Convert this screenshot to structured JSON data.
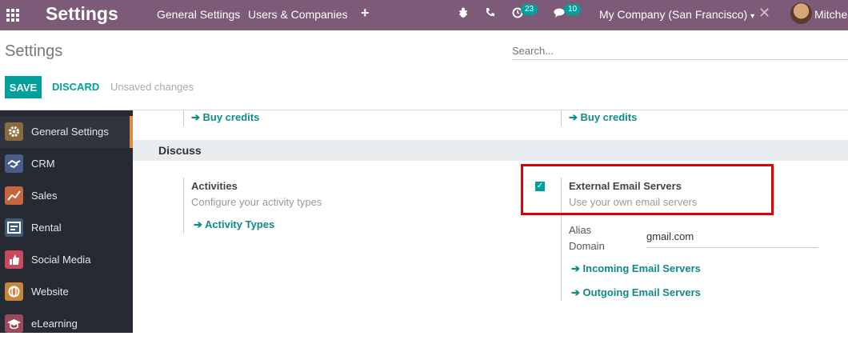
{
  "navbar": {
    "title": "Settings",
    "menu": [
      "General Settings",
      "Users & Companies"
    ],
    "add_icon": "+",
    "debug_icon": "bug-icon",
    "phone_icon": "phone-icon",
    "activity_badge": "23",
    "messages_badge": "10",
    "company": "My Company (San Francisco)",
    "company_caret": "▾",
    "user": "Mitchel"
  },
  "control_panel": {
    "title": "Settings",
    "search_placeholder": "Search...",
    "save_label": "SAVE",
    "discard_label": "DISCARD",
    "status": "Unsaved changes"
  },
  "sidebar": {
    "items": [
      {
        "label": "General Settings",
        "icon": "gear-icon",
        "color": "#8a6b3e"
      },
      {
        "label": "CRM",
        "icon": "handshake-icon",
        "color": "#4a5c8a"
      },
      {
        "label": "Sales",
        "icon": "chart-icon",
        "color": "#c8653c"
      },
      {
        "label": "Rental",
        "icon": "rental-icon",
        "color": "#3e5a7c"
      },
      {
        "label": "Social Media",
        "icon": "thumbs-up-icon",
        "color": "#c84a5c"
      },
      {
        "label": "Website",
        "icon": "globe-icon",
        "color": "#c8853c"
      },
      {
        "label": "eLearning",
        "icon": "elearning-icon",
        "color": "#9a4a5c"
      }
    ]
  },
  "main": {
    "buy_credits_left": "Buy credits",
    "buy_credits_right": "Buy credits",
    "section_title": "Discuss",
    "activities": {
      "title": "Activities",
      "desc": "Configure your activity types",
      "link": "Activity Types"
    },
    "email": {
      "title": "External Email Servers",
      "desc": "Use your own email servers",
      "checked": true,
      "alias_label_1": "Alias",
      "alias_label_2": "Domain",
      "alias_value": "gmail.com",
      "incoming_link": "Incoming Email Servers",
      "outgoing_link": "Outgoing Email Servers"
    }
  },
  "colors": {
    "navbar": "#7c5a78",
    "accent": "#00a09d",
    "highlight": "#e00000"
  }
}
